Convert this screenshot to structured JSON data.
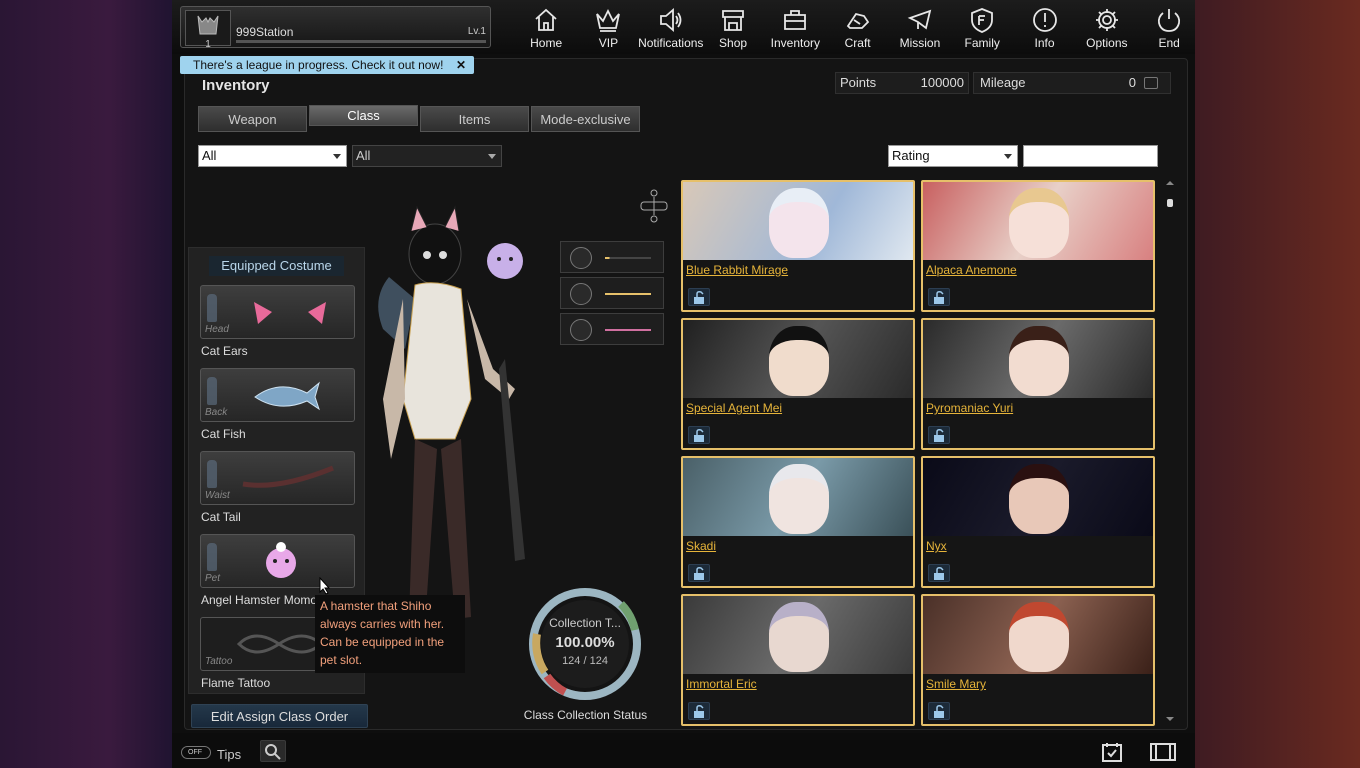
{
  "profile": {
    "rank": "1",
    "name": "999Station",
    "level": "Lv.1"
  },
  "nav": [
    {
      "label": "Home",
      "icon": "home-icon"
    },
    {
      "label": "VIP",
      "icon": "crown-icon"
    },
    {
      "label": "Notifications",
      "icon": "speaker-icon"
    },
    {
      "label": "Shop",
      "icon": "shop-icon"
    },
    {
      "label": "Inventory",
      "icon": "briefcase-icon"
    },
    {
      "label": "Craft",
      "icon": "craft-icon"
    },
    {
      "label": "Mission",
      "icon": "mission-icon"
    },
    {
      "label": "Family",
      "icon": "family-shield-icon"
    },
    {
      "label": "Info",
      "icon": "info-icon"
    },
    {
      "label": "Options",
      "icon": "gear-icon"
    },
    {
      "label": "End",
      "icon": "power-icon"
    }
  ],
  "league_banner": "There's a league in progress. Check it out now!",
  "title": "Inventory",
  "points": {
    "label": "Points",
    "value": "100000"
  },
  "mileage": {
    "label": "Mileage",
    "value": "0"
  },
  "tabs": [
    "Weapon",
    "Class",
    "Items",
    "Mode-exclusive"
  ],
  "filters": {
    "filter1": "All",
    "filter2": "All",
    "sort": "Rating",
    "search_value": ""
  },
  "costume": {
    "header": "Equipped Costume",
    "slots": [
      {
        "category": "Head",
        "name": "Cat Ears"
      },
      {
        "category": "Back",
        "name": "Cat Fish"
      },
      {
        "category": "Waist",
        "name": "Cat Tail"
      },
      {
        "category": "Pet",
        "name": "Angel Hamster Momo"
      },
      {
        "category": "Tattoo",
        "name": "Flame Tattoo"
      }
    ]
  },
  "tooltip": "A hamster that Shiho always carries with her. Can be equipped in the pet slot.",
  "edit_button": "Edit Assign Class Order",
  "collection": {
    "title": "Collection T...",
    "percent": "100.00%",
    "count": "124 / 124",
    "progress": 1.0,
    "label": "Class Collection Status"
  },
  "cards": [
    {
      "name": "Blue Rabbit Mirage"
    },
    {
      "name": "Alpaca Anemone"
    },
    {
      "name": "Special Agent Mei"
    },
    {
      "name": "Pyromaniac Yuri"
    },
    {
      "name": "Skadi"
    },
    {
      "name": "Nyx"
    },
    {
      "name": "Immortal Eric"
    },
    {
      "name": "Smile Mary"
    }
  ],
  "bottom": {
    "toggle": "OFF",
    "tips": "Tips"
  },
  "colors": {
    "accent_gold": "#e6c06a",
    "banner": "#9fd3ee",
    "name_gold": "#e6b43a"
  }
}
